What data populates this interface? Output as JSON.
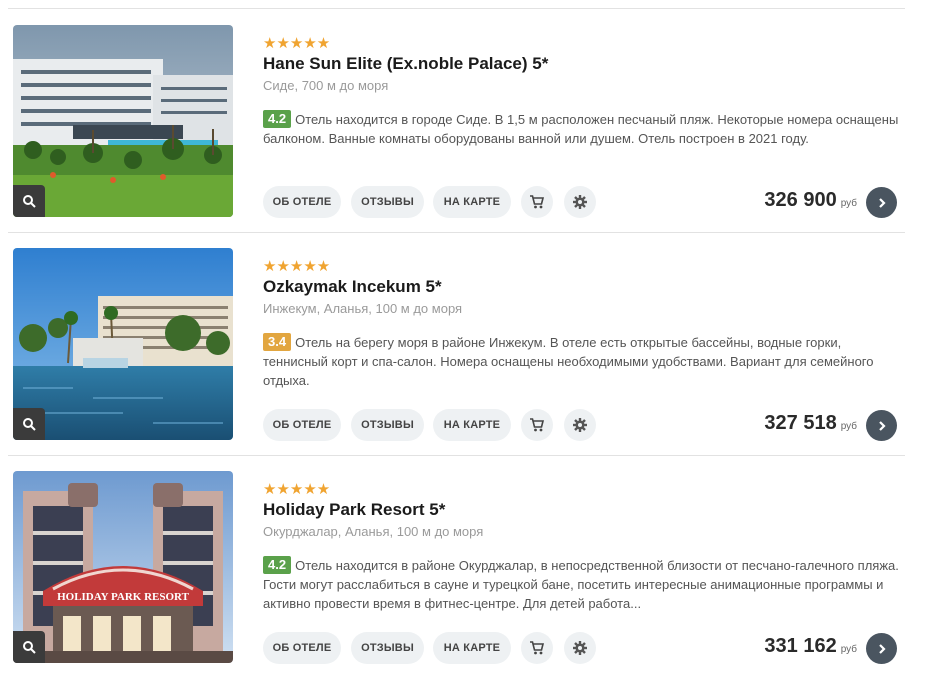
{
  "hotels": [
    {
      "stars": "★★★★★",
      "name": "Hane Sun Elite (Ex.noble Palace) 5*",
      "location": "Сиде, 700 м до моря",
      "rating": "4.2",
      "rating_color": "#5aa14a",
      "description": "Отель находится в городе Сиде. В 1,5 м расположен песчаный пляж. Некоторые номера оснащены балконом. Ванные комнаты оборудованы ванной или душем. Отель построен в 2021 году.",
      "price": "326 900",
      "currency": "руб"
    },
    {
      "stars": "★★★★★",
      "name": "Ozkaymak Incekum 5*",
      "location": "Инжекум, Аланья, 100 м до моря",
      "rating": "3.4",
      "rating_color": "#e2a640",
      "description": "Отель на берегу моря в районе Инжекум. В отеле есть открытые бассейны, водные горки, теннисный корт и спа-салон. Номера оснащены необходимыми удобствами. Вариант для семейного отдыха.",
      "price": "327 518",
      "currency": "руб"
    },
    {
      "stars": "★★★★★",
      "name": "Holiday Park Resort 5*",
      "location": "Окурджалар, Аланья, 100 м до моря",
      "rating": "4.2",
      "rating_color": "#5aa14a",
      "description": "Отель находится в районе Окурджалар, в непосредственной близости от песчано-галечного пляжа. Гости могут расслабиться в сауне и турецкой бане, посетить интересные анимационные программы и активно провести время в фитнес-центре. Для детей работа...",
      "price": "331 162",
      "currency": "руб",
      "sign_text": "HOLIDAY PARK RESORT"
    }
  ],
  "buttons": {
    "about": "ОБ ОТЕЛЕ",
    "reviews": "ОТЗЫВЫ",
    "map": "НА КАРТЕ"
  },
  "icons": {
    "zoom": "search-icon",
    "cart": "cart-icon",
    "settings": "gear-icon",
    "go": "chevron-right-icon"
  }
}
